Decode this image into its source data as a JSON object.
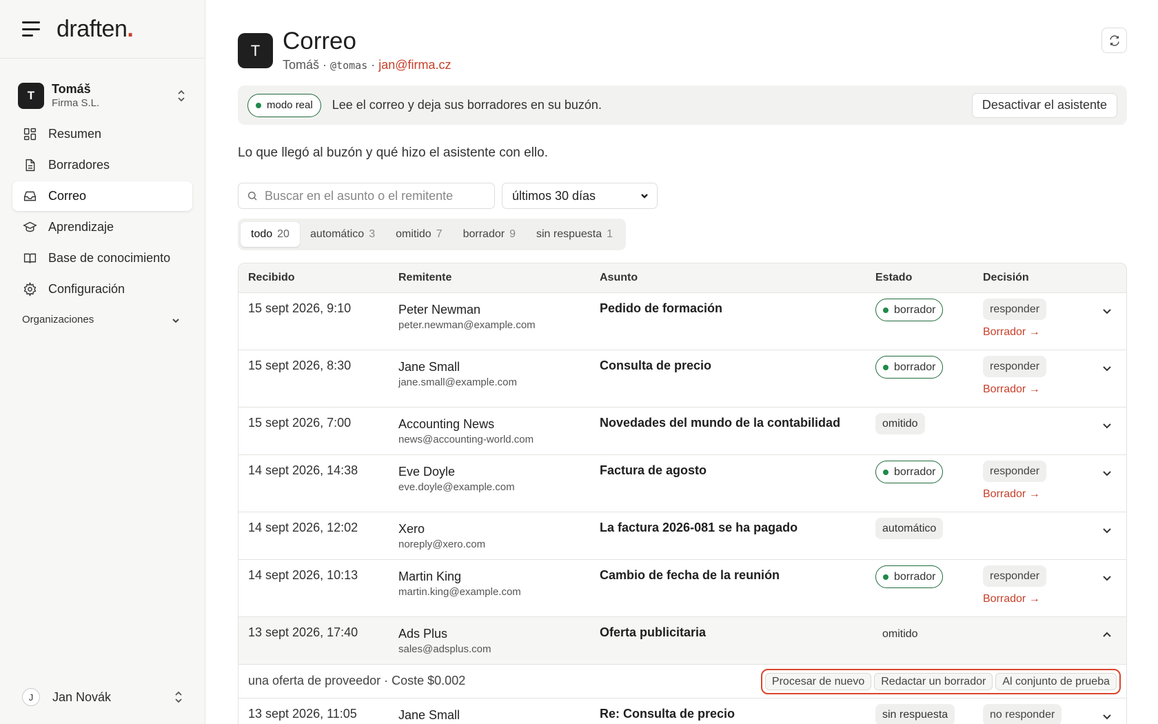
{
  "brand": {
    "name": "draften",
    "dot": "."
  },
  "account": {
    "initial": "T",
    "name": "Tomáš",
    "company": "Firma S.L."
  },
  "nav": [
    {
      "label": "Resumen",
      "icon": "dashboard-icon"
    },
    {
      "label": "Borradores",
      "icon": "document-icon"
    },
    {
      "label": "Correo",
      "icon": "inbox-icon",
      "active": true
    },
    {
      "label": "Aprendizaje",
      "icon": "graduation-cap-icon"
    },
    {
      "label": "Base de conocimiento",
      "icon": "book-icon"
    },
    {
      "label": "Configuración",
      "icon": "gear-icon"
    }
  ],
  "organizations_label": "Organizaciones",
  "user": {
    "initial": "J",
    "name": "Jan Novák"
  },
  "page": {
    "avatar_initial": "T",
    "title": "Correo",
    "sub_name": "Tomáš",
    "sub_sep": "·",
    "sub_handle": "@tomas",
    "sub_email": "jan@firma.cz"
  },
  "banner": {
    "mode": "modo real",
    "text": "Lee el correo y deja sus borradores en su buzón.",
    "button": "Desactivar el asistente"
  },
  "lead": "Lo que llegó al buzón y qué hizo el asistente con ello.",
  "search": {
    "placeholder": "Buscar en el asunto o el remitente",
    "value": ""
  },
  "period": {
    "selected": "últimos 30 días"
  },
  "filters": [
    {
      "label": "todo",
      "count": "20",
      "active": true
    },
    {
      "label": "automático",
      "count": "3"
    },
    {
      "label": "omitido",
      "count": "7"
    },
    {
      "label": "borrador",
      "count": "9"
    },
    {
      "label": "sin respuesta",
      "count": "1"
    }
  ],
  "table": {
    "headers": {
      "received": "Recibido",
      "sender": "Remitente",
      "subject": "Asunto",
      "state": "Estado",
      "decision": "Decisión"
    },
    "rows": [
      {
        "received": "15 sept 2026, 9:10",
        "sender": "Peter Newman",
        "email": "peter.newman@example.com",
        "subject": "Pedido de formación",
        "state": "borrador",
        "state_kind": "draft",
        "decision": "responder",
        "link": "Borrador →"
      },
      {
        "received": "15 sept 2026, 8:30",
        "sender": "Jane Small",
        "email": "jane.small@example.com",
        "subject": "Consulta de precio",
        "state": "borrador",
        "state_kind": "draft",
        "decision": "responder",
        "link": "Borrador →"
      },
      {
        "received": "15 sept 2026, 7:00",
        "sender": "Accounting News",
        "email": "news@accounting-world.com",
        "subject": "Novedades del mundo de la contabilidad",
        "state": "omitido",
        "state_kind": "muted",
        "decision": "",
        "link": ""
      },
      {
        "received": "14 sept 2026, 14:38",
        "sender": "Eve Doyle",
        "email": "eve.doyle@example.com",
        "subject": "Factura de agosto",
        "state": "borrador",
        "state_kind": "draft",
        "decision": "responder",
        "link": "Borrador →"
      },
      {
        "received": "14 sept 2026, 12:02",
        "sender": "Xero",
        "email": "noreply@xero.com",
        "subject": "La factura 2026-081 se ha pagado",
        "state": "automático",
        "state_kind": "muted",
        "decision": "",
        "link": ""
      },
      {
        "received": "14 sept 2026, 10:13",
        "sender": "Martin King",
        "email": "martin.king@example.com",
        "subject": "Cambio de fecha de la reunión",
        "state": "borrador",
        "state_kind": "draft",
        "decision": "responder",
        "link": "Borrador →"
      },
      {
        "received": "13 sept 2026, 17:40",
        "sender": "Ads Plus",
        "email": "sales@adsplus.com",
        "subject": "Oferta publicitaria",
        "state": "omitido",
        "state_kind": "plain",
        "decision": "",
        "link": "",
        "expanded": true
      },
      {
        "received": "13 sept 2026, 11:05",
        "sender": "Jane Small",
        "email": "",
        "subject": "Re: Consulta de precio",
        "state": "sin respuesta",
        "state_kind": "muted",
        "decision": "no responder",
        "link": ""
      }
    ],
    "detail": {
      "text": "una oferta de proveedor · Coste $0.002",
      "actions": [
        "Procesar de nuevo",
        "Redactar un borrador",
        "Al conjunto de prueba"
      ]
    }
  },
  "colors": {
    "accent": "#c8402a",
    "success": "#1f8a4a",
    "highlight": "#d9452b"
  }
}
